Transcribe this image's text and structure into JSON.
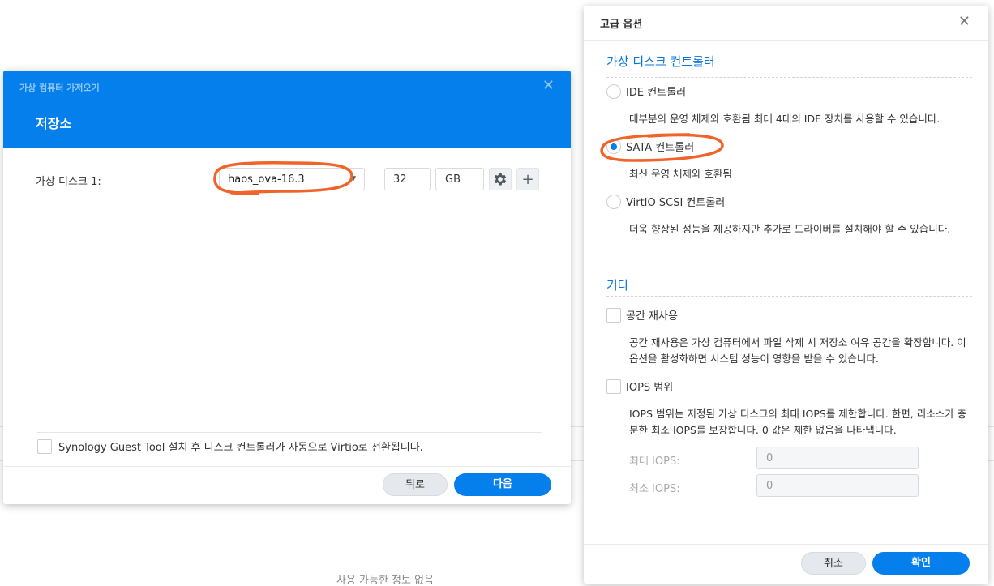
{
  "background": {
    "empty_text": "사용 가능한 정보 없음"
  },
  "wizard": {
    "title": "가상 컴퓨터 가져오기",
    "step_title": "저장소",
    "disk_label": "가상 디스크 1:",
    "disk_select_value": "haos_ova-16.3",
    "disk_size": "32",
    "disk_unit": "GB",
    "guest_tool_label": "Synology Guest Tool 설치 후 디스크 컨트롤러가 자동으로 Virtio로 전환됩니다.",
    "back_label": "뒤로",
    "next_label": "다음"
  },
  "advanced": {
    "title": "고급 옵션",
    "controller_section": "가상 디스크 컨트롤러",
    "controllers": [
      {
        "label": "IDE 컨트롤러",
        "desc": "대부분의 운영 체제와 호환됨 최대 4대의 IDE 장치를 사용할 수 있습니다.",
        "selected": false
      },
      {
        "label": "SATA 컨트롤러",
        "desc": "최신 운영 체제와 호환됨",
        "selected": true
      },
      {
        "label": "VirtIO SCSI 컨트롤러",
        "desc": "더욱 향상된 성능을 제공하지만 추가로 드라이버를 설치해야 할 수 있습니다.",
        "selected": false
      }
    ],
    "other_section": "기타",
    "space_reclaim_label": "공간 재사용",
    "space_reclaim_desc": "공간 재사용은 가상 컴퓨터에서 파일 삭제 시 저장소 여유 공간을 확장합니다. 이 옵션을 활성화하면 시스템 성능이 영향을 받을 수 있습니다.",
    "iops_label": "IOPS 범위",
    "iops_desc": "IOPS 범위는 지정된 가상 디스크의 최대 IOPS를 제한합니다. 한편, 리소스가 충분한 최소 IOPS를 보장합니다. 0 값은 제한 없음을 나타냅니다.",
    "max_iops_label": "최대 IOPS:",
    "max_iops_value": "0",
    "min_iops_label": "최소 IOPS:",
    "min_iops_value": "0",
    "cancel_label": "취소",
    "ok_label": "확인"
  },
  "colors": {
    "accent": "#057feb",
    "annotation": "#f0642a"
  }
}
